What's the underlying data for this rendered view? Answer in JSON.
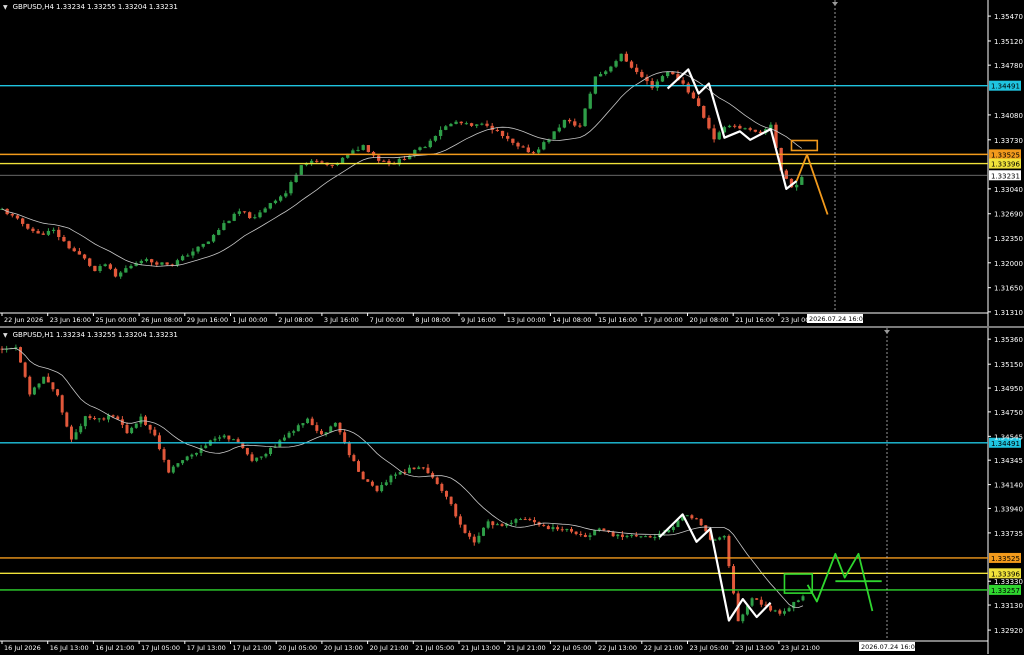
{
  "colors": {
    "background": "#000000",
    "bull": "#2e9e48",
    "bear": "#e2583b",
    "ma": "#c8c8c8",
    "cyan": "#1fc4e0",
    "orange": "#f29a1c",
    "yellow": "#f0e23a",
    "green": "#2fd62f",
    "white": "#ffffff",
    "grid_text": "#ffffff",
    "current_line": "#8a8a8a"
  },
  "charts": [
    {
      "id": "h4",
      "symbol": "GBPUSD,H4",
      "ohlc": [
        "1.33234",
        "1.33255",
        "1.33204",
        "1.33231"
      ],
      "cursor_label": "2026.07.24 16:00"
    },
    {
      "id": "h1",
      "symbol": "GBPUSD,H1",
      "ohlc": [
        "1.33234",
        "1.33255",
        "1.33204",
        "1.33231"
      ],
      "cursor_label": "2026.07.24 16:00"
    }
  ],
  "chart_data": [
    {
      "type": "candlestick",
      "title": "GBPUSD,H4",
      "ylim": [
        1.3128,
        1.3564
      ],
      "y_ticks": [
        "1.35470",
        "1.35120",
        "1.34780",
        "1.34491",
        "1.34080",
        "1.33730",
        "1.33525",
        "1.33396",
        "1.33231",
        "1.33040",
        "1.32690",
        "1.32350",
        "1.32000",
        "1.31650",
        "1.31310"
      ],
      "x_ticks": [
        "22 Jun 2026",
        "23 Jun 16:00",
        "25 Jun 00:00",
        "26 Jun 08:00",
        "29 Jun 16:00",
        "1 Jul 00:00",
        "2 Jul 08:00",
        "3 Jul 16:00",
        "7 Jul 00:00",
        "8 Jul 08:00",
        "9 Jul 16:00",
        "13 Jul 00:00",
        "14 Jul 08:00",
        "15 Jul 16:00",
        "17 Jul 00:00",
        "20 Jul 08:00",
        "21 Jul 16:00",
        "23 Jul 00:"
      ],
      "levels": [
        {
          "value": 1.34491,
          "label": "1.34491",
          "color": "cyan"
        },
        {
          "value": 1.33525,
          "label": "1.33525",
          "color": "orange"
        },
        {
          "value": 1.33396,
          "label": "1.33396",
          "color": "yellow"
        },
        {
          "value": 1.33231,
          "label": "1.33231",
          "color": "current"
        }
      ],
      "close_path": [
        [
          0,
          1.3275
        ],
        [
          4,
          1.3255
        ],
        [
          7,
          1.324
        ],
        [
          10,
          1.3245
        ],
        [
          13,
          1.3222
        ],
        [
          16,
          1.3205
        ],
        [
          18,
          1.3188
        ],
        [
          20,
          1.3198
        ],
        [
          22,
          1.318
        ],
        [
          24,
          1.3192
        ],
        [
          27,
          1.3205
        ],
        [
          30,
          1.32
        ],
        [
          33,
          1.3198
        ],
        [
          36,
          1.3212
        ],
        [
          40,
          1.323
        ],
        [
          43,
          1.3255
        ],
        [
          46,
          1.3272
        ],
        [
          49,
          1.3262
        ],
        [
          52,
          1.3285
        ],
        [
          55,
          1.3298
        ],
        [
          58,
          1.334
        ],
        [
          61,
          1.3342
        ],
        [
          64,
          1.3335
        ],
        [
          67,
          1.3352
        ],
        [
          70,
          1.3365
        ],
        [
          73,
          1.3345
        ],
        [
          76,
          1.334
        ],
        [
          79,
          1.3352
        ],
        [
          82,
          1.3365
        ],
        [
          85,
          1.3388
        ],
        [
          88,
          1.3398
        ],
        [
          91,
          1.3392
        ],
        [
          94,
          1.3395
        ],
        [
          97,
          1.3378
        ],
        [
          100,
          1.3362
        ],
        [
          103,
          1.3355
        ],
        [
          106,
          1.3375
        ],
        [
          109,
          1.34
        ],
        [
          112,
          1.3392
        ],
        [
          115,
          1.3462
        ],
        [
          117,
          1.347
        ],
        [
          120,
          1.3492
        ],
        [
          123,
          1.3468
        ],
        [
          126,
          1.3448
        ],
        [
          129,
          1.347
        ],
        [
          132,
          1.3452
        ],
        [
          135,
          1.342
        ],
        [
          138,
          1.3375
        ],
        [
          141,
          1.3395
        ],
        [
          144,
          1.3388
        ],
        [
          147,
          1.338
        ],
        [
          149,
          1.3395
        ],
        [
          151,
          1.333
        ],
        [
          153,
          1.3306
        ],
        [
          155,
          1.3318
        ]
      ],
      "patterns": {
        "white_zigzag": [
          [
            129,
            1.3445
          ],
          [
            133,
            1.3472
          ],
          [
            135,
            1.3438
          ],
          [
            137,
            1.3452
          ],
          [
            140,
            1.3376
          ],
          [
            143,
            1.3385
          ],
          [
            145,
            1.3373
          ],
          [
            149,
            1.3388
          ],
          [
            152,
            1.3304
          ],
          [
            154,
            1.3315
          ]
        ],
        "orange_projection": [
          [
            154,
            1.3315
          ],
          [
            156,
            1.3352
          ],
          [
            160,
            1.3268
          ]
        ],
        "orange_box": {
          "t0": 153,
          "t1": 158,
          "v0": 1.3372,
          "v1": 1.3358
        }
      }
    },
    {
      "type": "candlestick",
      "title": "GBPUSD,H1",
      "ylim": [
        1.3282,
        1.3542
      ],
      "y_ticks": [
        "1.35360",
        "1.35150",
        "1.34950",
        "1.34750",
        "1.34545",
        "1.34491",
        "1.34345",
        "1.34140",
        "1.33940",
        "1.33735",
        "1.33525",
        "1.33396",
        "1.33330",
        "1.33257",
        "1.33130",
        "1.32920"
      ],
      "x_ticks": [
        "16 Jul 2026",
        "16 Jul 13:00",
        "16 Jul 21:00",
        "17 Jul 05:00",
        "17 Jul 13:00",
        "17 Jul 21:00",
        "20 Jul 05:00",
        "20 Jul 13:00",
        "20 Jul 21:00",
        "21 Jul 05:00",
        "21 Jul 13:00",
        "21 Jul 21:00",
        "22 Jul 05:00",
        "22 Jul 13:00",
        "22 Jul 21:00",
        "23 Jul 05:00",
        "23 Jul 13:00",
        "23 Jul 21:00"
      ],
      "levels": [
        {
          "value": 1.34491,
          "label": "1.34491",
          "color": "cyan"
        },
        {
          "value": 1.33525,
          "label": "1.33525",
          "color": "orange"
        },
        {
          "value": 1.33396,
          "label": "1.33396",
          "color": "yellow"
        },
        {
          "value": 1.33257,
          "label": "1.33257",
          "color": "green"
        }
      ],
      "close_path": [
        [
          0,
          1.3528
        ],
        [
          3,
          1.353
        ],
        [
          6,
          1.349
        ],
        [
          9,
          1.3505
        ],
        [
          12,
          1.3488
        ],
        [
          15,
          1.3452
        ],
        [
          18,
          1.347
        ],
        [
          21,
          1.3468
        ],
        [
          24,
          1.3472
        ],
        [
          27,
          1.3458
        ],
        [
          30,
          1.347
        ],
        [
          33,
          1.3455
        ],
        [
          36,
          1.3425
        ],
        [
          39,
          1.3435
        ],
        [
          42,
          1.344
        ],
        [
          45,
          1.345
        ],
        [
          48,
          1.3455
        ],
        [
          51,
          1.345
        ],
        [
          54,
          1.3435
        ],
        [
          57,
          1.344
        ],
        [
          60,
          1.345
        ],
        [
          63,
          1.346
        ],
        [
          66,
          1.3468
        ],
        [
          69,
          1.3455
        ],
        [
          72,
          1.3465
        ],
        [
          75,
          1.344
        ],
        [
          78,
          1.3418
        ],
        [
          81,
          1.341
        ],
        [
          84,
          1.342
        ],
        [
          87,
          1.3425
        ],
        [
          90,
          1.343
        ],
        [
          93,
          1.342
        ],
        [
          96,
          1.3405
        ],
        [
          99,
          1.338
        ],
        [
          102,
          1.3365
        ],
        [
          105,
          1.3382
        ],
        [
          108,
          1.3378
        ],
        [
          111,
          1.3385
        ],
        [
          114,
          1.3385
        ],
        [
          117,
          1.3378
        ],
        [
          120,
          1.3378
        ],
        [
          123,
          1.3375
        ],
        [
          126,
          1.337
        ],
        [
          129,
          1.3378
        ],
        [
          132,
          1.3372
        ],
        [
          135,
          1.337
        ],
        [
          138,
          1.3372
        ],
        [
          141,
          1.337
        ],
        [
          144,
          1.3375
        ],
        [
          147,
          1.3388
        ],
        [
          150,
          1.3385
        ],
        [
          153,
          1.3368
        ],
        [
          156,
          1.337
        ],
        [
          159,
          1.33
        ],
        [
          162,
          1.3318
        ],
        [
          165,
          1.3312
        ],
        [
          168,
          1.3305
        ],
        [
          171,
          1.3315
        ],
        [
          173,
          1.332
        ]
      ],
      "patterns": {
        "white_zigzag": [
          [
            142,
            1.337
          ],
          [
            147,
            1.3389
          ],
          [
            150,
            1.3366
          ],
          [
            153,
            1.3377
          ],
          [
            157,
            1.33
          ],
          [
            160,
            1.3318
          ],
          [
            163,
            1.3303
          ],
          [
            166,
            1.3315
          ]
        ],
        "green_projection": [
          [
            174,
            1.333
          ],
          [
            176,
            1.3316
          ],
          [
            180,
            1.3356
          ],
          [
            182,
            1.3336
          ],
          [
            185,
            1.3356
          ],
          [
            188,
            1.3308
          ]
        ],
        "green_box": {
          "t0": 169,
          "t1": 175,
          "v0": 1.3339,
          "v1": 1.3323
        },
        "green_hline": {
          "t0": 180,
          "t1": 190,
          "v": 1.3333
        }
      }
    }
  ]
}
